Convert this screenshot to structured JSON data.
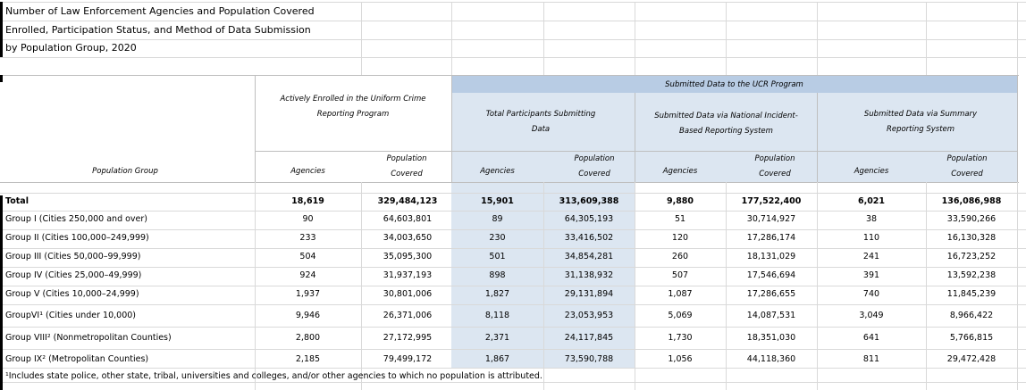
{
  "title_lines": [
    "Number of Law Enforcement Agencies and Population Covered",
    "Enrolled, Participation Status, and Method of Data Submission",
    "by Population Group, 2020"
  ],
  "headers": {
    "submitted_ucr": "Submitted Data to the UCR Program",
    "actively_enrolled": "Actively Enrolled in the Uniform Crime Reporting Program",
    "total_participants": "Total Participants Submitting Data",
    "nibrs": "Submitted Data via National Incident-Based Reporting System",
    "srs": "Submitted Data via Summary Reporting System",
    "population_group": "Population Group",
    "agencies": "Agencies",
    "population_covered": "Population Covered"
  },
  "rows": [
    {
      "label": "Total",
      "values": [
        "18,619",
        "329,484,123",
        "15,901",
        "313,609,388",
        "9,880",
        "177,522,400",
        "6,021",
        "136,086,988"
      ]
    },
    {
      "label": "Group I (Cities 250,000 and over)",
      "values": [
        "90",
        "64,603,801",
        "89",
        "64,305,193",
        "51",
        "30,714,927",
        "38",
        "33,590,266"
      ]
    },
    {
      "label": "Group II (Cities 100,000–249,999)",
      "values": [
        "233",
        "34,003,650",
        "230",
        "33,416,502",
        "120",
        "17,286,174",
        "110",
        "16,130,328"
      ]
    },
    {
      "label": "Group III (Cities 50,000–99,999)",
      "values": [
        "504",
        "35,095,300",
        "501",
        "34,854,281",
        "260",
        "18,131,029",
        "241",
        "16,723,252"
      ]
    },
    {
      "label": "Group IV (Cities 25,000–49,999)",
      "values": [
        "924",
        "31,937,193",
        "898",
        "31,138,932",
        "507",
        "17,546,694",
        "391",
        "13,592,238"
      ]
    },
    {
      "label": "Group V (Cities 10,000–24,999)",
      "values": [
        "1,937",
        "30,801,006",
        "1,827",
        "29,131,894",
        "1,087",
        "17,286,655",
        "740",
        "11,845,239"
      ]
    },
    {
      "label": "GroupVI¹ (Cities under 10,000)",
      "values": [
        "9,946",
        "26,371,006",
        "8,118",
        "23,053,953",
        "5,069",
        "14,087,531",
        "3,049",
        "8,966,422"
      ]
    },
    {
      "label": "Group VIII² (Nonmetropolitan Counties)",
      "values": [
        "2,800",
        "27,172,995",
        "2,371",
        "24,117,845",
        "1,730",
        "18,351,030",
        "641",
        "5,766,815"
      ]
    },
    {
      "label": "Group IX² (Metropolitan Counties)",
      "values": [
        "2,185",
        "79,499,172",
        "1,867",
        "73,590,788",
        "1,056",
        "44,118,360",
        "811",
        "29,472,428"
      ]
    }
  ],
  "footnote": "¹Includes state police, other state, tribal, universities and colleges, and/or other agencies to which no population is attributed."
}
